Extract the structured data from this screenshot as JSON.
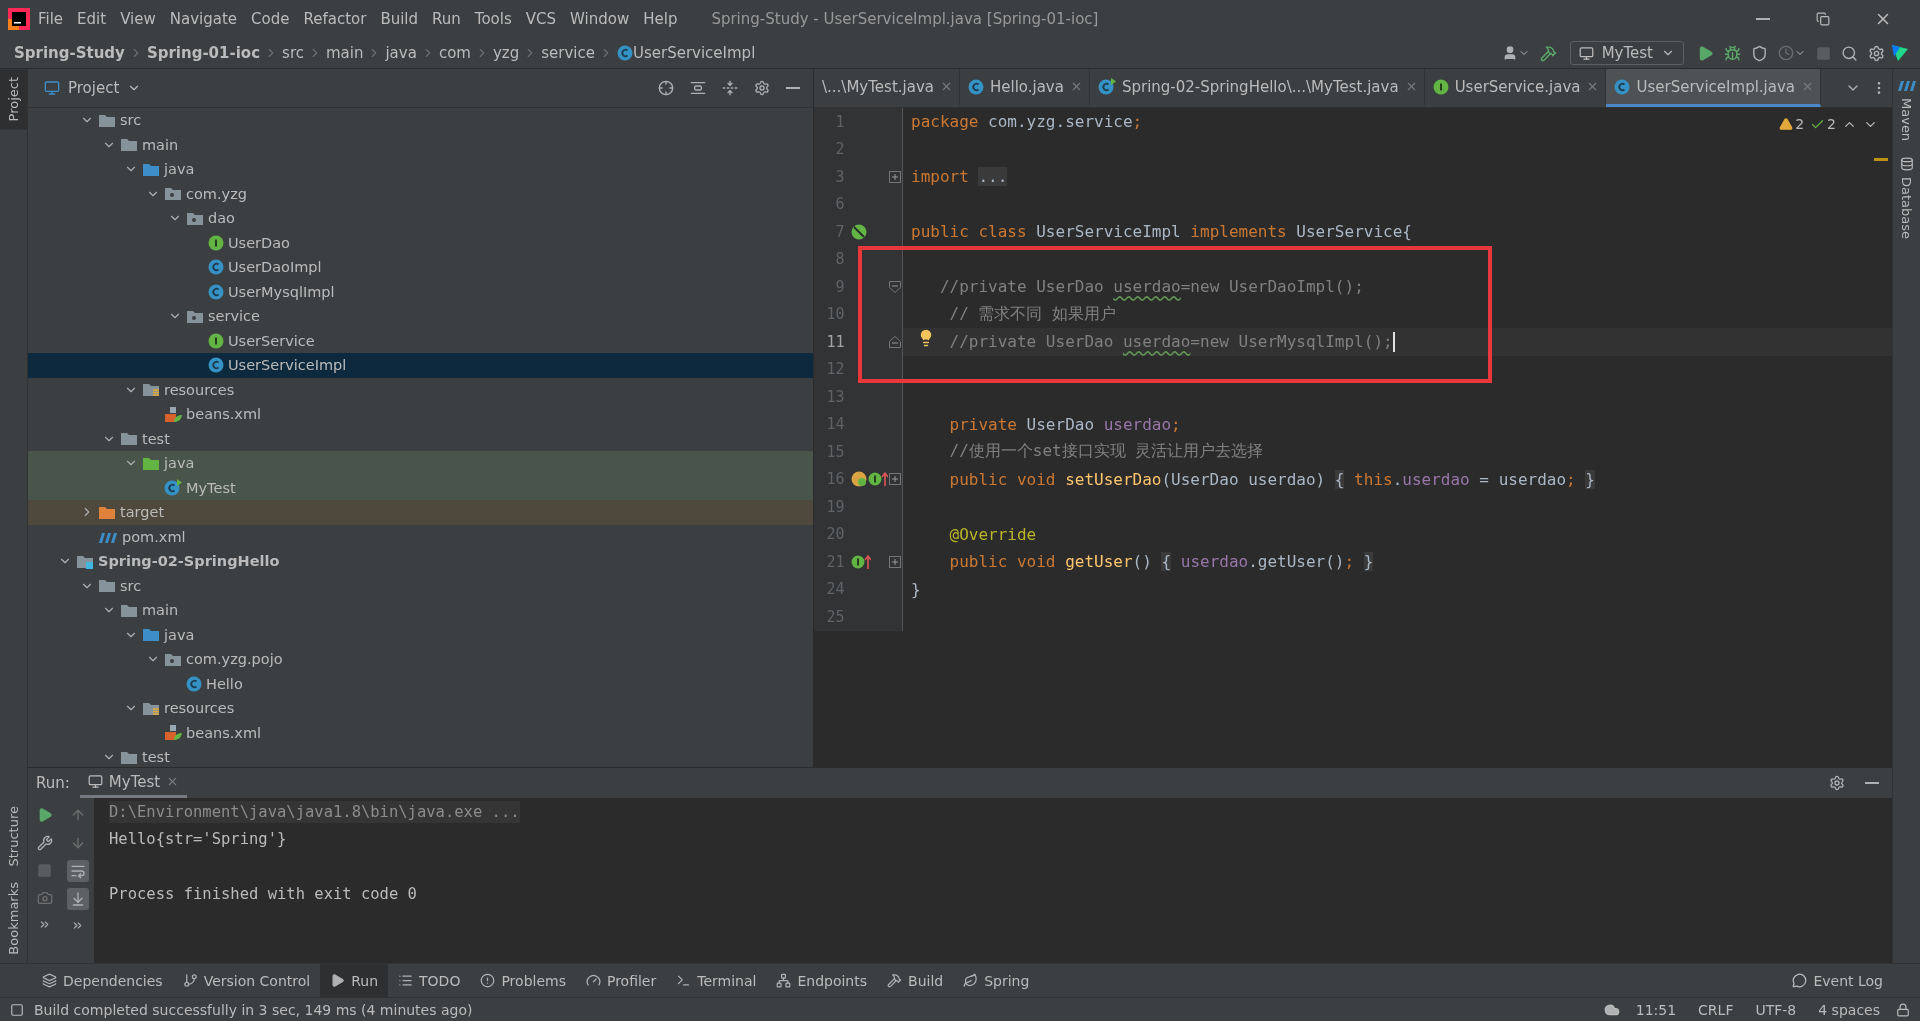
{
  "menu_bar": {
    "items": [
      "File",
      "Edit",
      "View",
      "Navigate",
      "Code",
      "Refactor",
      "Build",
      "Run",
      "Tools",
      "VCS",
      "Window",
      "Help"
    ],
    "title": "Spring-Study - UserServiceImpl.java [Spring-01-ioc]"
  },
  "nav_bar": {
    "breadcrumbs": [
      {
        "label": "Spring-Study",
        "kind": "project"
      },
      {
        "label": "Spring-01-ioc",
        "kind": "project"
      },
      {
        "label": "src",
        "kind": "dir"
      },
      {
        "label": "main",
        "kind": "dir"
      },
      {
        "label": "java",
        "kind": "dir"
      },
      {
        "label": "com",
        "kind": "dir"
      },
      {
        "label": "yzg",
        "kind": "dir"
      },
      {
        "label": "service",
        "kind": "dir"
      },
      {
        "label": "UserServiceImpl",
        "kind": "class"
      }
    ],
    "run_config": "MyTest"
  },
  "left_stripe": [
    {
      "label": "Project",
      "selected": true
    },
    {
      "label": "Structure",
      "selected": false
    },
    {
      "label": "Bookmarks",
      "selected": false
    }
  ],
  "right_stripe": [
    {
      "label": "Maven",
      "kind": "maven"
    },
    {
      "label": "Database",
      "kind": "database"
    }
  ],
  "project_panel": {
    "title": "Project",
    "scrolled_items": [
      {
        "label": "src",
        "kind": "folder",
        "expanded": true,
        "selected": false,
        "children": [
          {
            "label": "main",
            "kind": "folder",
            "expanded": true,
            "selected": false,
            "children": [
              {
                "label": "java",
                "kind": "src-folder",
                "expanded": true,
                "selected": false,
                "children": [
                  {
                    "label": "com.yzg",
                    "kind": "package",
                    "expanded": true,
                    "selected": false,
                    "children": [
                      {
                        "label": "dao",
                        "kind": "package",
                        "expanded": true,
                        "selected": false,
                        "children": [
                          {
                            "label": "UserDao",
                            "kind": "interface",
                            "selected": false
                          },
                          {
                            "label": "UserDaoImpl",
                            "kind": "class",
                            "selected": false
                          },
                          {
                            "label": "UserMysqlImpl",
                            "kind": "class",
                            "selected": false
                          }
                        ]
                      },
                      {
                        "label": "service",
                        "kind": "package",
                        "expanded": true,
                        "selected": false,
                        "children": [
                          {
                            "label": "UserService",
                            "kind": "interface",
                            "selected": false
                          },
                          {
                            "label": "UserServiceImpl",
                            "kind": "class",
                            "selected": true
                          }
                        ]
                      }
                    ]
                  }
                ]
              },
              {
                "label": "resources",
                "kind": "resources",
                "expanded": true,
                "selected": false,
                "children": [
                  {
                    "label": "beans.xml",
                    "kind": "xml",
                    "selected": false
                  }
                ]
              }
            ]
          },
          {
            "label": "test",
            "kind": "folder",
            "expanded": true,
            "selected": false,
            "children": [
              {
                "label": "java",
                "kind": "test-folder",
                "expanded": true,
                "selected": false,
                "children": [
                  {
                    "label": "MyTest",
                    "kind": "test-class",
                    "selected": false
                  }
                ]
              }
            ]
          }
        ]
      },
      {
        "label": "target",
        "kind": "excluded",
        "expanded": false,
        "selected": false
      },
      {
        "label": "pom.xml",
        "kind": "maven",
        "selected": false
      }
    ],
    "items": [
      {
        "label": "Spring-02-SpringHello",
        "kind": "module",
        "expanded": true,
        "selected": false,
        "children": [
          {
            "label": "src",
            "kind": "folder",
            "expanded": true,
            "selected": false,
            "children": [
              {
                "label": "main",
                "kind": "folder",
                "expanded": true,
                "selected": false,
                "children": [
                  {
                    "label": "java",
                    "kind": "src-folder",
                    "expanded": true,
                    "selected": false,
                    "children": [
                      {
                        "label": "com.yzg.pojo",
                        "kind": "package",
                        "expanded": true,
                        "selected": false,
                        "children": [
                          {
                            "label": "Hello",
                            "kind": "class",
                            "selected": false
                          }
                        ]
                      }
                    ]
                  },
                  {
                    "label": "resources",
                    "kind": "resources",
                    "expanded": true,
                    "selected": false,
                    "children": [
                      {
                        "label": "beans.xml",
                        "kind": "xml",
                        "selected": false
                      }
                    ]
                  }
                ]
              },
              {
                "label": "test",
                "kind": "folder",
                "expanded": true,
                "selected": false
              }
            ]
          }
        ]
      }
    ]
  },
  "editor": {
    "tabs": [
      {
        "label": "\\...\\MyTest.java",
        "kind": "none",
        "selected": false
      },
      {
        "label": "Hello.java",
        "kind": "class",
        "selected": false
      },
      {
        "label": "Spring-02-SpringHello\\...\\MyTest.java",
        "kind": "test-class",
        "selected": false
      },
      {
        "label": "UserService.java",
        "kind": "interface",
        "selected": false
      },
      {
        "label": "UserServiceImpl.java",
        "kind": "class",
        "selected": true
      }
    ],
    "warnings": "2",
    "weak_warnings": "2",
    "lines": [
      {
        "number": "1",
        "current": false,
        "boxed": false,
        "tokens": [
          {
            "text": "package ",
            "kind": "keyword"
          },
          {
            "text": "com.yzg.service",
            "kind": "plain"
          },
          {
            "text": ";",
            "kind": "keyword"
          }
        ]
      },
      {
        "number": "2",
        "current": false,
        "boxed": false
      },
      {
        "number": "3",
        "current": false,
        "boxed": false,
        "fold": {
          "kind": "collapsed"
        },
        "tokens": [
          {
            "text": "import ",
            "kind": "keyword"
          },
          {
            "text": "...",
            "kind": "folded"
          }
        ]
      },
      {
        "number": "6",
        "current": false,
        "boxed": false
      },
      {
        "number": "7",
        "current": false,
        "boxed": false,
        "markers": [
          {
            "kind": "bean"
          }
        ],
        "tokens": [
          {
            "text": "public class ",
            "kind": "keyword"
          },
          {
            "text": "UserServiceImpl ",
            "kind": "plain"
          },
          {
            "text": "implements ",
            "kind": "keyword"
          },
          {
            "text": "UserService{",
            "kind": "plain"
          }
        ]
      },
      {
        "number": "8",
        "current": false,
        "boxed": true
      },
      {
        "number": "9",
        "current": false,
        "boxed": true,
        "fold": {
          "kind": "start"
        },
        "tokens": [
          {
            "text": "   //private UserDao ",
            "kind": "comment"
          },
          {
            "text": "userdao",
            "kind": "typo"
          },
          {
            "text": "=new UserDaoImpl();",
            "kind": "comment"
          }
        ]
      },
      {
        "number": "10",
        "current": false,
        "boxed": true,
        "tokens": [
          {
            "text": "    // 需求不同 如果用户",
            "kind": "comment"
          }
        ]
      },
      {
        "number": "11",
        "current": true,
        "boxed": true,
        "fold": {
          "kind": "end"
        },
        "markers": [
          {
            "kind": "bulb"
          }
        ],
        "tokens": [
          {
            "text": "    //private UserDao ",
            "kind": "comment"
          },
          {
            "text": "userdao",
            "kind": "typo"
          },
          {
            "text": "=new UserMysqlImpl();",
            "kind": "comment"
          }
        ]
      },
      {
        "number": "12",
        "current": false,
        "boxed": true
      },
      {
        "number": "13",
        "current": false,
        "boxed": false
      },
      {
        "number": "14",
        "current": false,
        "boxed": false,
        "tokens": [
          {
            "text": "    private ",
            "kind": "keyword"
          },
          {
            "text": "UserDao ",
            "kind": "plain"
          },
          {
            "text": "userdao",
            "kind": "field"
          },
          {
            "text": ";",
            "kind": "keyword"
          }
        ]
      },
      {
        "number": "15",
        "current": false,
        "boxed": false,
        "tokens": [
          {
            "text": "    //使用一个set接口实现 灵活让用户去选择",
            "kind": "comment"
          }
        ]
      },
      {
        "number": "16",
        "current": false,
        "boxed": false,
        "fold": {
          "kind": "collapsed"
        },
        "markers": [
          {
            "kind": "setter"
          },
          {
            "kind": "implements"
          }
        ],
        "tokens": [
          {
            "text": "    public void ",
            "kind": "keyword"
          },
          {
            "text": "setUserDao",
            "kind": "method"
          },
          {
            "text": "(UserDao userdao) ",
            "kind": "plain"
          },
          {
            "text": "{",
            "kind": "folded"
          },
          {
            "text": " this",
            "kind": "keyword"
          },
          {
            "text": ".",
            "kind": "plain"
          },
          {
            "text": "userdao",
            "kind": "field"
          },
          {
            "text": " = userdao",
            "kind": "plain"
          },
          {
            "text": "; ",
            "kind": "keyword"
          },
          {
            "text": "}",
            "kind": "folded"
          }
        ]
      },
      {
        "number": "19",
        "current": false,
        "boxed": false
      },
      {
        "number": "20",
        "current": false,
        "boxed": false,
        "tokens": [
          {
            "text": "    @Override",
            "kind": "annotation"
          }
        ]
      },
      {
        "number": "21",
        "current": false,
        "boxed": false,
        "fold": {
          "kind": "collapsed"
        },
        "markers": [
          {
            "kind": "implements"
          }
        ],
        "tokens": [
          {
            "text": "    public void ",
            "kind": "keyword"
          },
          {
            "text": "getUser",
            "kind": "method"
          },
          {
            "text": "() ",
            "kind": "plain"
          },
          {
            "text": "{",
            "kind": "folded"
          },
          {
            "text": " userdao",
            "kind": "field"
          },
          {
            "text": ".getUser()",
            "kind": "plain"
          },
          {
            "text": "; ",
            "kind": "keyword"
          },
          {
            "text": "}",
            "kind": "folded"
          }
        ]
      },
      {
        "number": "24",
        "current": false,
        "boxed": false,
        "tokens": [
          {
            "text": "}",
            "kind": "plain"
          }
        ]
      },
      {
        "number": "25",
        "current": false,
        "boxed": false
      }
    ]
  },
  "run_panel": {
    "label": "Run:",
    "tabs": [
      {
        "label": "MyTest",
        "selected": true
      }
    ],
    "toggles": [
      {
        "kind": "soft-wrap",
        "selected": true
      },
      {
        "kind": "scroll-end",
        "selected": true
      }
    ],
    "output": [
      {
        "text": "D:\\Environment\\java\\java1.8\\bin\\java.exe ...",
        "kind": "command"
      },
      {
        "text": "Hello{str='Spring'}",
        "kind": "stdout"
      },
      {
        "kind": "blank"
      },
      {
        "text": "Process finished with exit code 0",
        "kind": "stdout"
      }
    ]
  },
  "tool_windows": [
    {
      "label": "Dependencies",
      "kind": "layers",
      "selected": false
    },
    {
      "label": "Version Control",
      "kind": "vcs",
      "selected": false
    },
    {
      "label": "Run",
      "kind": "run",
      "selected": true
    },
    {
      "label": "TODO",
      "kind": "list",
      "selected": false
    },
    {
      "label": "Problems",
      "kind": "problems",
      "selected": false
    },
    {
      "label": "Profiler",
      "kind": "profiler",
      "selected": false
    },
    {
      "label": "Terminal",
      "kind": "terminal",
      "selected": false
    },
    {
      "label": "Endpoints",
      "kind": "endpoints",
      "selected": false
    },
    {
      "label": "Build",
      "kind": "build",
      "selected": false
    },
    {
      "label": "Spring",
      "kind": "spring",
      "selected": false
    }
  ],
  "event_log": "Event Log",
  "status_bar": {
    "message": "Build completed successfully in 3 sec, 149 ms (4 minutes ago)",
    "items": [
      "11:51",
      "CRLF",
      "UTF-8",
      "4 spaces"
    ]
  }
}
